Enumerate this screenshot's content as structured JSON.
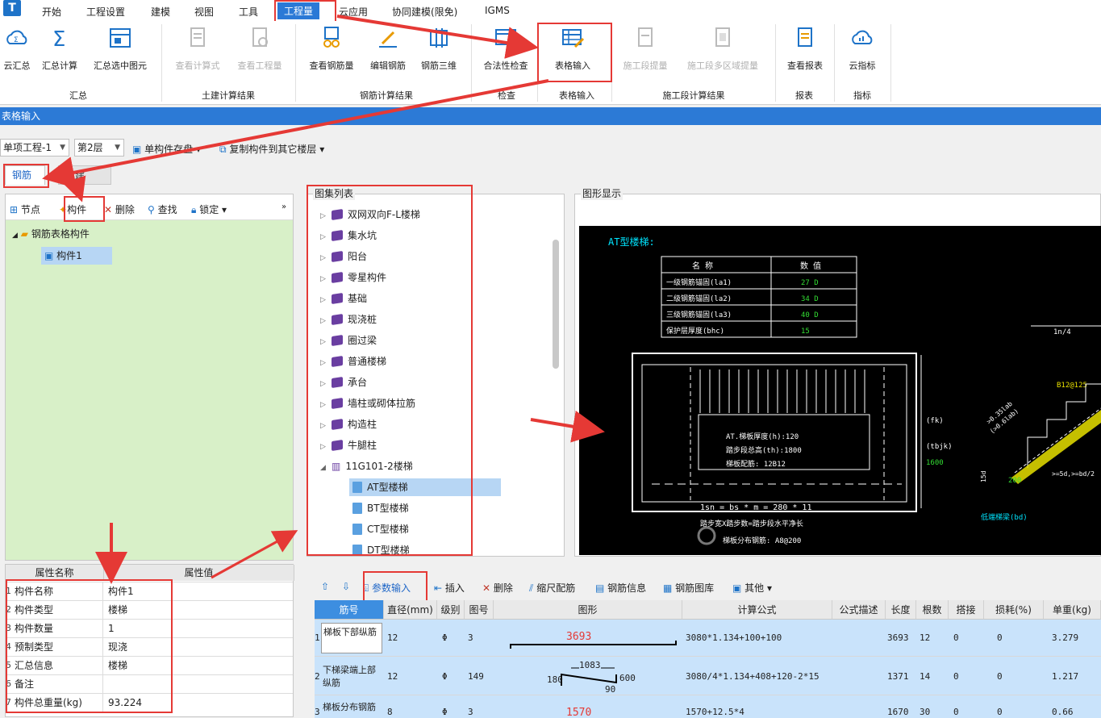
{
  "menu": {
    "logo": "T",
    "items": [
      "开始",
      "工程设置",
      "建模",
      "视图",
      "工具",
      "工程量",
      "云应用",
      "协同建模(限免)",
      "IGMS"
    ],
    "active": "工程量"
  },
  "ribbon": {
    "buttons": [
      "云汇总",
      "汇总计算",
      "汇总选中图元",
      "查看计算式",
      "查看工程量",
      "查看钢筋量",
      "编辑钢筋",
      "钢筋三维",
      "合法性检查",
      "表格输入",
      "施工段提量",
      "施工段多区域提量",
      "查看报表",
      "云指标"
    ],
    "groups": [
      "汇总",
      "土建计算结果",
      "钢筋计算结果",
      "检查",
      "表格输入",
      "施工段计算结果",
      "报表",
      "指标"
    ]
  },
  "window_title": "表格输入",
  "toolbar": {
    "project": "单项工程-1",
    "floor": "第2层",
    "single_save": "单构件存盘",
    "copy_to_floor": "复制构件到其它楼层"
  },
  "tabs": [
    "钢筋",
    "土建"
  ],
  "left_tools": [
    "节点",
    "构件",
    "删除",
    "查找",
    "锁定"
  ],
  "tree": {
    "root": "钢筋表格构件",
    "child": "构件1"
  },
  "properties": {
    "headers": [
      "属性名称",
      "属性值"
    ],
    "rows": [
      {
        "n": "1",
        "k": "构件名称",
        "v": "构件1"
      },
      {
        "n": "2",
        "k": "构件类型",
        "v": "楼梯"
      },
      {
        "n": "3",
        "k": "构件数量",
        "v": "1"
      },
      {
        "n": "4",
        "k": "预制类型",
        "v": "现浇"
      },
      {
        "n": "5",
        "k": "汇总信息",
        "v": "楼梯"
      },
      {
        "n": "6",
        "k": "备注",
        "v": ""
      },
      {
        "n": "7",
        "k": "构件总重量(kg)",
        "v": "93.224"
      }
    ]
  },
  "atlas": {
    "title": "图集列表",
    "items": [
      "双网双向F-L楼梯",
      "集水坑",
      "阳台",
      "零星构件",
      "基础",
      "现浇桩",
      "圈过梁",
      "普通楼梯",
      "承台",
      "墙柱或砌体拉筋",
      "构造柱",
      "牛腿柱",
      "11G101-2楼梯"
    ],
    "children": [
      "AT型楼梯",
      "BT型楼梯",
      "CT型楼梯",
      "DT型楼梯"
    ]
  },
  "graphic": {
    "title": "图形显示",
    "cad_title": "AT型楼梯:",
    "table_headers": [
      "名 称",
      "数 值"
    ],
    "table_rows": [
      [
        "一级钢筋锚固(la1)",
        "27 D"
      ],
      [
        "二级钢筋锚固(la2)",
        "34 D"
      ],
      [
        "三级钢筋锚固(la3)",
        "40 D"
      ],
      [
        "保护层厚度(bhc)",
        "15"
      ]
    ],
    "notes": [
      "AT.梯板厚度(h):120",
      "踏步段总高(th):1800",
      "梯板配筋: 12B12"
    ],
    "dims": [
      "(fk)",
      "(tbjk)",
      "1600",
      "1n/4",
      "B12@125",
      "200",
      "15d",
      ">=5d,>=bd/2",
      ">0.35lab",
      "(>0.6lab)",
      "低端梯梁(bd)"
    ],
    "bottom": [
      "1sn = bs * m = 280 * 11",
      "踏步宽X踏步数=踏步段水平净长",
      "梯板分布钢筋: A8@200"
    ]
  },
  "bottom_tools": [
    "参数输入",
    "插入",
    "删除",
    "缩尺配筋",
    "钢筋信息",
    "钢筋图库",
    "其他"
  ],
  "grid": {
    "headers": [
      "筋号",
      "直径(mm)",
      "级别",
      "图号",
      "图形",
      "计算公式",
      "公式描述",
      "长度",
      "根数",
      "搭接",
      "损耗(%)",
      "单重(kg)"
    ],
    "rows": [
      {
        "n": "1",
        "name": "梯板下部纵筋",
        "dia": "12",
        "grade": "Φ",
        "fig": "3",
        "shape": "3693",
        "formula": "3080*1.134+100+100",
        "desc": "",
        "len": "3693",
        "qty": "12",
        "lap": "0",
        "loss": "0",
        "w": "3.279"
      },
      {
        "n": "2",
        "name": "下梯梁端上部纵筋",
        "dia": "12",
        "grade": "Φ",
        "fig": "149",
        "shape": "1083",
        "shape_a": "180",
        "shape_b": "600",
        "shape_c": "90",
        "formula": "3080/4*1.134+408+120-2*15",
        "desc": "",
        "len": "1371",
        "qty": "14",
        "lap": "0",
        "loss": "0",
        "w": "1.217"
      },
      {
        "n": "3",
        "name": "梯板分布钢筋",
        "dia": "8",
        "grade": "Φ",
        "fig": "3",
        "shape": "1570",
        "formula": "1570+12.5*4",
        "desc": "",
        "len": "1670",
        "qty": "30",
        "lap": "0",
        "loss": "0",
        "w": "0.66"
      }
    ]
  },
  "colors": {
    "accent": "#2c7ad6",
    "highlight": "#e53935",
    "tree_bg": "#d8f0c8",
    "row_bg": "#c9e3fb",
    "cad_cyan": "#00e5ff",
    "cad_green": "#33dd33",
    "cad_yellow": "#e8e000"
  }
}
